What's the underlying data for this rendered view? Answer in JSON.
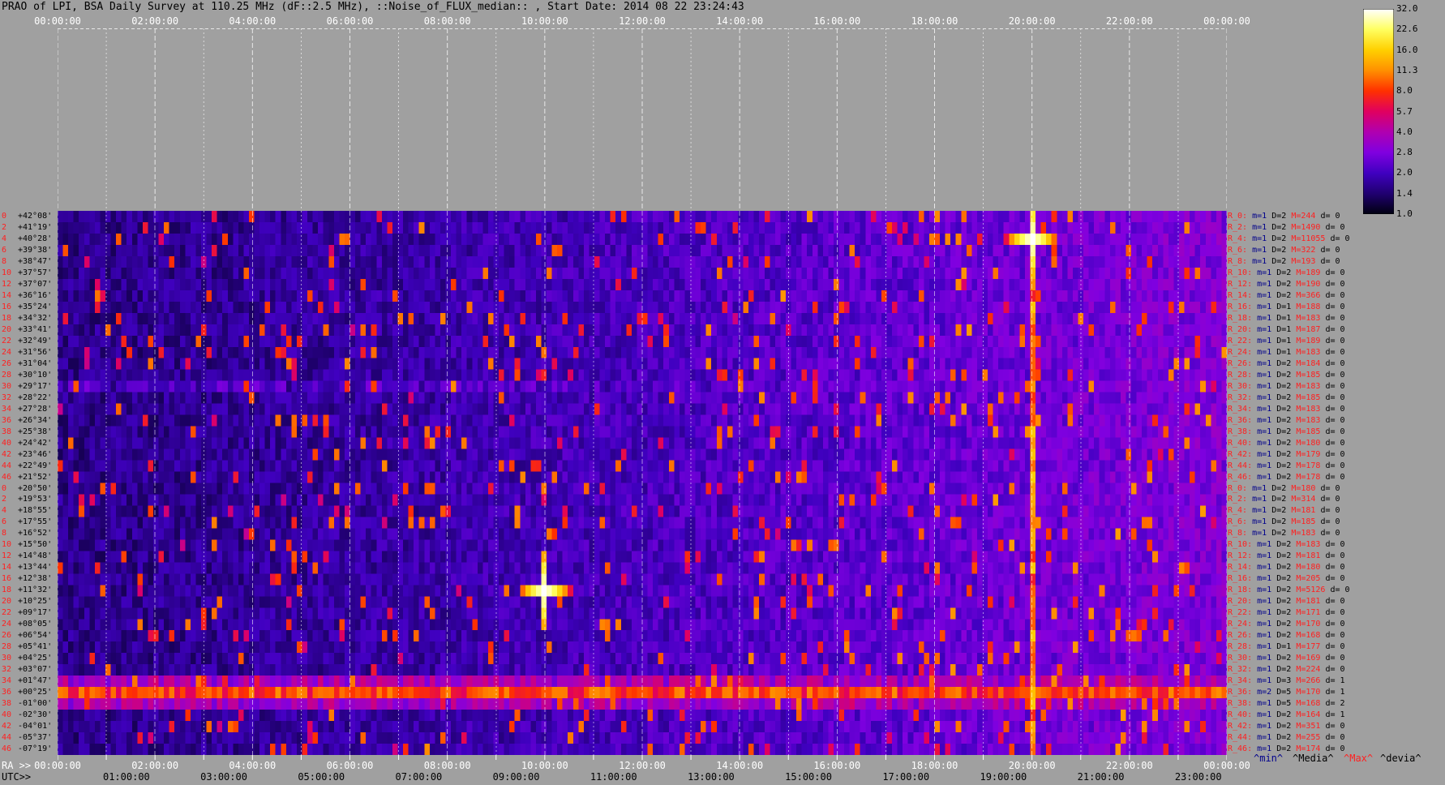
{
  "title": "PRAO of LPI, BSA Daily Survey at 110.25 MHz (dF::2.5 MHz), ::Noise_of_FLUX_median:: , Start Date: 2014 08 22 23:24:43",
  "top_ticks": [
    "00:00:00",
    "02:00:00",
    "04:00:00",
    "06:00:00",
    "08:00:00",
    "10:00:00",
    "12:00:00",
    "14:00:00",
    "16:00:00",
    "18:00:00",
    "20:00:00",
    "22:00:00",
    "00:00:00"
  ],
  "ra_prefix": "RA >>",
  "ra_ticks": [
    "00:00:00",
    "02:00:00",
    "04:00:00",
    "06:00:00",
    "08:00:00",
    "10:00:00",
    "12:00:00",
    "14:00:00",
    "16:00:00",
    "18:00:00",
    "20:00:00",
    "22:00:00",
    "00:00:00"
  ],
  "utc_prefix": "UTC>>",
  "utc_ticks": [
    "01:00:00",
    "03:00:00",
    "05:00:00",
    "07:00:00",
    "09:00:00",
    "11:00:00",
    "13:00:00",
    "15:00:00",
    "17:00:00",
    "19:00:00",
    "21:00:00",
    "23:00:00"
  ],
  "dec_labels": [
    {
      "idx": "0",
      "val": "+42°08'"
    },
    {
      "idx": "2",
      "val": "+41°19'"
    },
    {
      "idx": "4",
      "val": "+40°28'"
    },
    {
      "idx": "6",
      "val": "+39°38'"
    },
    {
      "idx": "8",
      "val": "+38°47'"
    },
    {
      "idx": "10",
      "val": "+37°57'"
    },
    {
      "idx": "12",
      "val": "+37°07'"
    },
    {
      "idx": "14",
      "val": "+36°16'"
    },
    {
      "idx": "16",
      "val": "+35°24'"
    },
    {
      "idx": "18",
      "val": "+34°32'"
    },
    {
      "idx": "20",
      "val": "+33°41'"
    },
    {
      "idx": "22",
      "val": "+32°49'"
    },
    {
      "idx": "24",
      "val": "+31°56'"
    },
    {
      "idx": "26",
      "val": "+31°04'"
    },
    {
      "idx": "28",
      "val": "+30°10'"
    },
    {
      "idx": "30",
      "val": "+29°17'"
    },
    {
      "idx": "32",
      "val": "+28°22'"
    },
    {
      "idx": "34",
      "val": "+27°28'"
    },
    {
      "idx": "36",
      "val": "+26°34'"
    },
    {
      "idx": "38",
      "val": "+25°38'"
    },
    {
      "idx": "40",
      "val": "+24°42'"
    },
    {
      "idx": "42",
      "val": "+23°46'"
    },
    {
      "idx": "44",
      "val": "+22°49'"
    },
    {
      "idx": "46",
      "val": "+21°52'"
    },
    {
      "idx": "0",
      "val": "+20°50'"
    },
    {
      "idx": "2",
      "val": "+19°53'"
    },
    {
      "idx": "4",
      "val": "+18°55'"
    },
    {
      "idx": "6",
      "val": "+17°55'"
    },
    {
      "idx": "8",
      "val": "+16°52'"
    },
    {
      "idx": "10",
      "val": "+15°50'"
    },
    {
      "idx": "12",
      "val": "+14°48'"
    },
    {
      "idx": "14",
      "val": "+13°44'"
    },
    {
      "idx": "16",
      "val": "+12°38'"
    },
    {
      "idx": "18",
      "val": "+11°32'"
    },
    {
      "idx": "20",
      "val": "+10°25'"
    },
    {
      "idx": "22",
      "val": "+09°17'"
    },
    {
      "idx": "24",
      "val": "+08°05'"
    },
    {
      "idx": "26",
      "val": "+06°54'"
    },
    {
      "idx": "28",
      "val": "+05°41'"
    },
    {
      "idx": "30",
      "val": "+04°25'"
    },
    {
      "idx": "32",
      "val": "+03°07'"
    },
    {
      "idx": "34",
      "val": "+01°47'"
    },
    {
      "idx": "36",
      "val": "+00°25'"
    },
    {
      "idx": "38",
      "val": "-01°00'"
    },
    {
      "idx": "40",
      "val": "-02°30'"
    },
    {
      "idx": "42",
      "val": "-04°01'"
    },
    {
      "idx": "44",
      "val": "-05°37'"
    },
    {
      "idx": "46",
      "val": "-07°19'"
    }
  ],
  "row_stats": [
    {
      "r": "R_0:",
      "m": "m=1",
      "d": "D=2",
      "mx": "M=244",
      "dv": "d= 0"
    },
    {
      "r": "R_2:",
      "m": "m=1",
      "d": "D=2",
      "mx": "M=1490",
      "dv": "d= 0"
    },
    {
      "r": "R_4:",
      "m": "m=1",
      "d": "D=2",
      "mx": "M=11055",
      "dv": "d= 0"
    },
    {
      "r": "R_6:",
      "m": "m=1",
      "d": "D=2",
      "mx": "M=322",
      "dv": "d= 0"
    },
    {
      "r": "R_8:",
      "m": "m=1",
      "d": "D=2",
      "mx": "M=193",
      "dv": "d= 0"
    },
    {
      "r": "R_10:",
      "m": "m=1",
      "d": "D=2",
      "mx": "M=189",
      "dv": "d= 0"
    },
    {
      "r": "R_12:",
      "m": "m=1",
      "d": "D=2",
      "mx": "M=190",
      "dv": "d= 0"
    },
    {
      "r": "R_14:",
      "m": "m=1",
      "d": "D=2",
      "mx": "M=366",
      "dv": "d= 0"
    },
    {
      "r": "R_16:",
      "m": "m=1",
      "d": "D=1",
      "mx": "M=188",
      "dv": "d= 0"
    },
    {
      "r": "R_18:",
      "m": "m=1",
      "d": "D=1",
      "mx": "M=183",
      "dv": "d= 0"
    },
    {
      "r": "R_20:",
      "m": "m=1",
      "d": "D=1",
      "mx": "M=187",
      "dv": "d= 0"
    },
    {
      "r": "R_22:",
      "m": "m=1",
      "d": "D=1",
      "mx": "M=189",
      "dv": "d= 0"
    },
    {
      "r": "R_24:",
      "m": "m=1",
      "d": "D=1",
      "mx": "M=183",
      "dv": "d= 0"
    },
    {
      "r": "R_26:",
      "m": "m=1",
      "d": "D=2",
      "mx": "M=184",
      "dv": "d= 0"
    },
    {
      "r": "R_28:",
      "m": "m=1",
      "d": "D=2",
      "mx": "M=185",
      "dv": "d= 0"
    },
    {
      "r": "R_30:",
      "m": "m=1",
      "d": "D=2",
      "mx": "M=183",
      "dv": "d= 0"
    },
    {
      "r": "R_32:",
      "m": "m=1",
      "d": "D=2",
      "mx": "M=185",
      "dv": "d= 0"
    },
    {
      "r": "R_34:",
      "m": "m=1",
      "d": "D=2",
      "mx": "M=183",
      "dv": "d= 0"
    },
    {
      "r": "R_36:",
      "m": "m=1",
      "d": "D=2",
      "mx": "M=183",
      "dv": "d= 0"
    },
    {
      "r": "R_38:",
      "m": "m=1",
      "d": "D=2",
      "mx": "M=185",
      "dv": "d= 0"
    },
    {
      "r": "R_40:",
      "m": "m=1",
      "d": "D=2",
      "mx": "M=180",
      "dv": "d= 0"
    },
    {
      "r": "R_42:",
      "m": "m=1",
      "d": "D=2",
      "mx": "M=179",
      "dv": "d= 0"
    },
    {
      "r": "R_44:",
      "m": "m=1",
      "d": "D=2",
      "mx": "M=178",
      "dv": "d= 0"
    },
    {
      "r": "R_46:",
      "m": "m=1",
      "d": "D=2",
      "mx": "M=178",
      "dv": "d= 0"
    },
    {
      "r": "R_0:",
      "m": "m=1",
      "d": "D=2",
      "mx": "M=180",
      "dv": "d= 0"
    },
    {
      "r": "R_2:",
      "m": "m=1",
      "d": "D=2",
      "mx": "M=314",
      "dv": "d= 0"
    },
    {
      "r": "R_4:",
      "m": "m=1",
      "d": "D=2",
      "mx": "M=181",
      "dv": "d= 0"
    },
    {
      "r": "R_6:",
      "m": "m=1",
      "d": "D=2",
      "mx": "M=185",
      "dv": "d= 0"
    },
    {
      "r": "R_8:",
      "m": "m=1",
      "d": "D=2",
      "mx": "M=183",
      "dv": "d= 0"
    },
    {
      "r": "R_10:",
      "m": "m=1",
      "d": "D=2",
      "mx": "M=183",
      "dv": "d= 0"
    },
    {
      "r": "R_12:",
      "m": "m=1",
      "d": "D=2",
      "mx": "M=181",
      "dv": "d= 0"
    },
    {
      "r": "R_14:",
      "m": "m=1",
      "d": "D=2",
      "mx": "M=180",
      "dv": "d= 0"
    },
    {
      "r": "R_16:",
      "m": "m=1",
      "d": "D=2",
      "mx": "M=205",
      "dv": "d= 0"
    },
    {
      "r": "R_18:",
      "m": "m=1",
      "d": "D=2",
      "mx": "M=5126",
      "dv": "d= 0"
    },
    {
      "r": "R_20:",
      "m": "m=1",
      "d": "D=2",
      "mx": "M=181",
      "dv": "d= 0"
    },
    {
      "r": "R_22:",
      "m": "m=1",
      "d": "D=2",
      "mx": "M=171",
      "dv": "d= 0"
    },
    {
      "r": "R_24:",
      "m": "m=1",
      "d": "D=2",
      "mx": "M=170",
      "dv": "d= 0"
    },
    {
      "r": "R_26:",
      "m": "m=1",
      "d": "D=2",
      "mx": "M=168",
      "dv": "d= 0"
    },
    {
      "r": "R_28:",
      "m": "m=1",
      "d": "D=1",
      "mx": "M=177",
      "dv": "d= 0"
    },
    {
      "r": "R_30:",
      "m": "m=1",
      "d": "D=2",
      "mx": "M=169",
      "dv": "d= 0"
    },
    {
      "r": "R_32:",
      "m": "m=1",
      "d": "D=2",
      "mx": "M=224",
      "dv": "d= 0"
    },
    {
      "r": "R_34:",
      "m": "m=1",
      "d": "D=3",
      "mx": "M=266",
      "dv": "d= 1"
    },
    {
      "r": "R_36:",
      "m": "m=2",
      "d": "D=5",
      "mx": "M=170",
      "dv": "d= 1"
    },
    {
      "r": "R_38:",
      "m": "m=1",
      "d": "D=5",
      "mx": "M=168",
      "dv": "d= 2"
    },
    {
      "r": "R_40:",
      "m": "m=1",
      "d": "D=2",
      "mx": "M=164",
      "dv": "d= 1"
    },
    {
      "r": "R_42:",
      "m": "m=1",
      "d": "D=2",
      "mx": "M=351",
      "dv": "d= 0"
    },
    {
      "r": "R_44:",
      "m": "m=1",
      "d": "D=2",
      "mx": "M=255",
      "dv": "d= 0"
    },
    {
      "r": "R_46:",
      "m": "m=1",
      "d": "D=2",
      "mx": "M=174",
      "dv": "d= 0"
    }
  ],
  "stat_header": {
    "min": "^min^",
    "median": "^Media^",
    "max": "^Max^",
    "devia": "^devia^"
  },
  "colorbar": {
    "ticks": [
      "32.0",
      "22.6",
      "16.0",
      "11.3",
      "8.0",
      "5.7",
      "4.0",
      "2.8",
      "2.0",
      "1.4",
      "1.0"
    ],
    "colors": [
      "#ffffff",
      "#ffff60",
      "#ffd000",
      "#ff9000",
      "#ff3000",
      "#e00060",
      "#b000b0",
      "#8000e0",
      "#4000c0",
      "#200070",
      "#000010"
    ]
  },
  "chart_data": {
    "type": "heatmap",
    "title": "PRAO of LPI, BSA Daily Survey at 110.25 MHz (dF::2.5 MHz), ::Noise_of_FLUX_median:: , Start Date: 2014 08 22 23:24:43",
    "x": {
      "ra_range": [
        "00:00:00",
        "24:00:00"
      ],
      "utc_range": [
        "00:24:43",
        "24:24:43"
      ]
    },
    "y": {
      "dec_range": [
        "+42°08'",
        "-07°19'"
      ],
      "rows": 48
    },
    "color_scale": {
      "min": 1.0,
      "max": 32.0,
      "scale": "log2"
    },
    "features": [
      {
        "name": "bright source",
        "ra": "20:00",
        "dec": "+40°28'",
        "value": 32.0
      },
      {
        "name": "bright source",
        "ra": "10:00",
        "dec": "+11°32'",
        "value": 32.0
      },
      {
        "name": "horizontal band",
        "dec": "+00°25'",
        "value": 11.3
      },
      {
        "name": "horizontal line",
        "dec": "+29°17'",
        "value": 2.8
      },
      {
        "name": "vertical stripe",
        "ra": "20:00",
        "value": 16.0
      }
    ]
  }
}
